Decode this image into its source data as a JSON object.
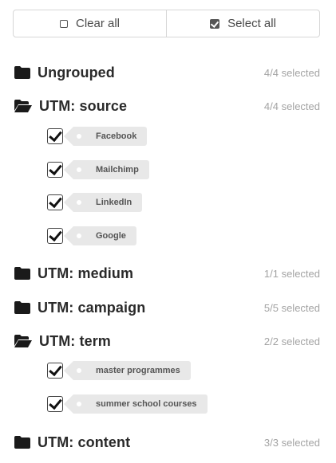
{
  "toolbar": {
    "clear_label": "Clear all",
    "select_label": "Select all"
  },
  "groups": [
    {
      "title": "Ungrouped",
      "count": "4/4 selected",
      "icon": "folder-closed"
    },
    {
      "title": "UTM: source",
      "count": "4/4 selected",
      "icon": "folder-open",
      "items": [
        "Facebook",
        "Mailchimp",
        "LinkedIn",
        "Google"
      ]
    },
    {
      "title": "UTM: medium",
      "count": "1/1 selected",
      "icon": "folder-closed"
    },
    {
      "title": "UTM: campaign",
      "count": "5/5 selected",
      "icon": "folder-closed"
    },
    {
      "title": "UTM: term",
      "count": "2/2 selected",
      "icon": "folder-open",
      "items": [
        "master programmes",
        "summer school courses"
      ]
    },
    {
      "title": "UTM: content",
      "count": "3/3 selected",
      "icon": "folder-closed"
    }
  ]
}
